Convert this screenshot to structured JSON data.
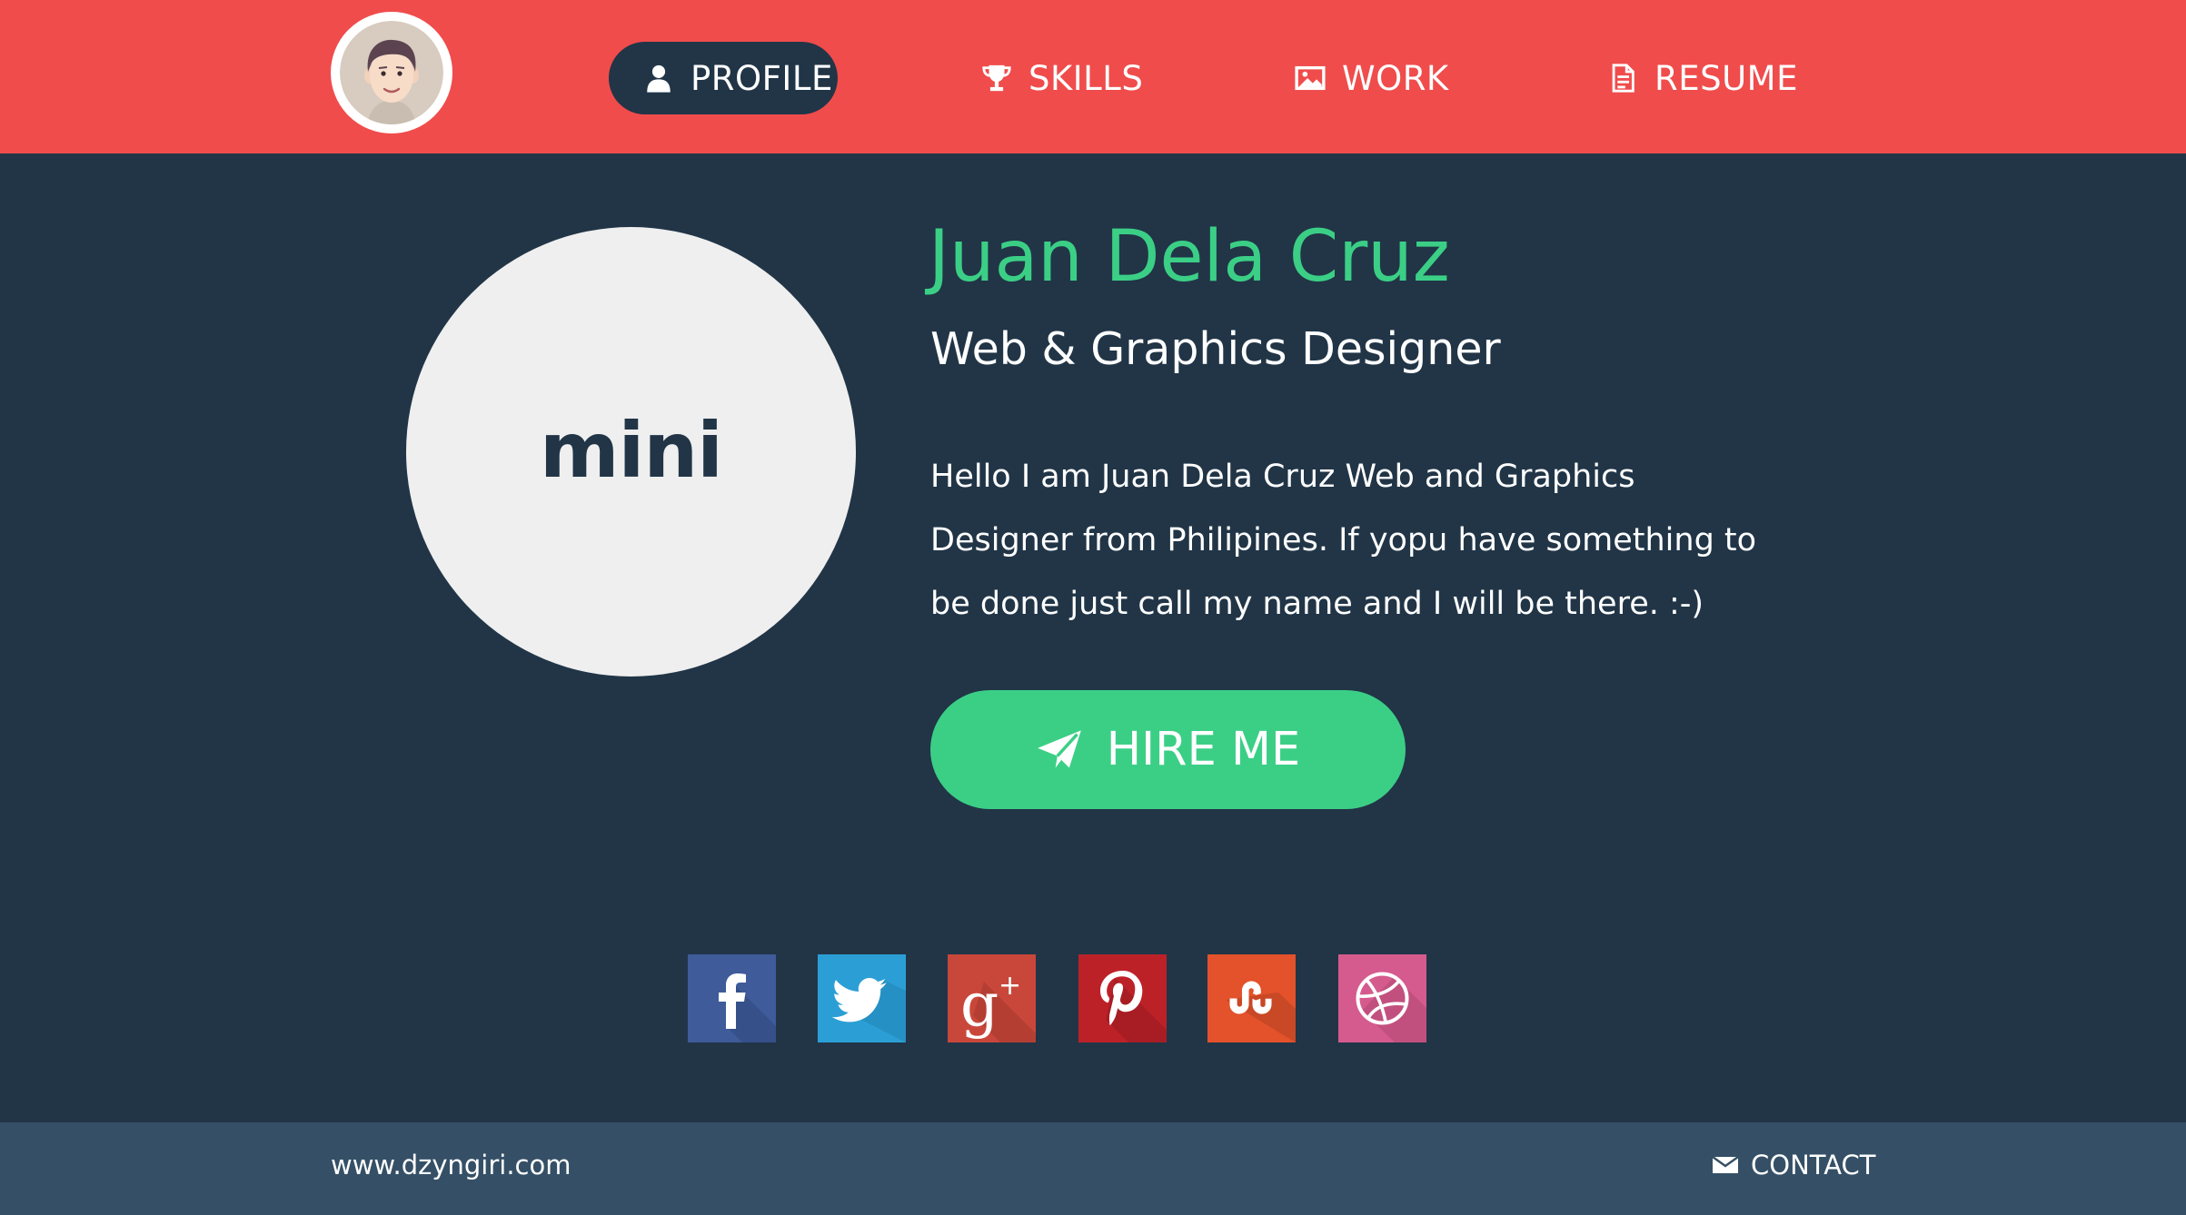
{
  "nav": {
    "items": [
      {
        "label": "PROFILE",
        "icon": "user-icon",
        "active": true
      },
      {
        "label": "SKILLS",
        "icon": "trophy-icon",
        "active": false
      },
      {
        "label": "WORK",
        "icon": "image-icon",
        "active": false
      },
      {
        "label": "RESUME",
        "icon": "document-icon",
        "active": false
      }
    ]
  },
  "hero": {
    "logo_text": "mini",
    "name": "Juan Dela Cruz",
    "role": "Web & Graphics Designer",
    "bio": "Hello I am Juan Dela Cruz Web and Graphics Designer from Philipines. If yopu have something to be done just call my name and I will be there. :-)",
    "hire_label": "HIRE ME"
  },
  "social": [
    {
      "name": "facebook",
      "color": "#3f5b9a"
    },
    {
      "name": "twitter",
      "color": "#2b9fd5"
    },
    {
      "name": "google-plus",
      "color": "#c9473a"
    },
    {
      "name": "pinterest",
      "color": "#bd2128"
    },
    {
      "name": "stumbleupon",
      "color": "#e3522a"
    },
    {
      "name": "dribbble",
      "color": "#d55b8e"
    }
  ],
  "footer": {
    "site": "www.dzyngiri.com",
    "contact_label": "CONTACT"
  },
  "colors": {
    "header_bg": "#f04c4c",
    "body_bg": "#213547",
    "accent": "#3bcf86",
    "footer_bg": "#355066"
  }
}
